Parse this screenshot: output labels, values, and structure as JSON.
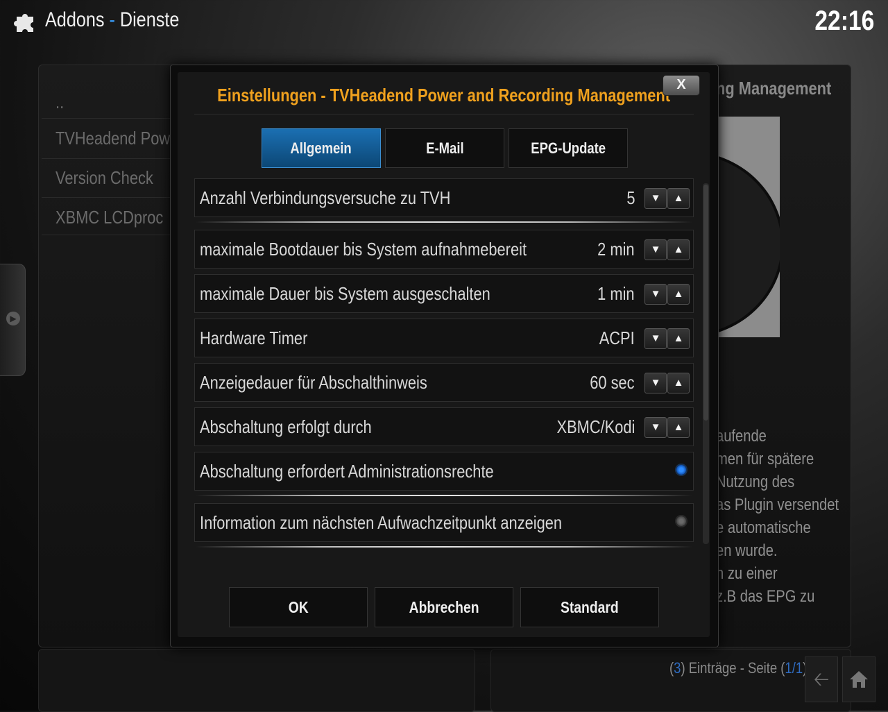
{
  "header": {
    "section": "Addons",
    "separator": "-",
    "category": "Dienste",
    "icon": "puzzle-icon",
    "time": "22:16"
  },
  "background": {
    "list": [
      "..",
      "TVHeadend Power",
      "Version Check",
      "XBMC LCDproc"
    ],
    "heading": "ng Management",
    "description": [
      "aufende",
      "men für spätere",
      "Nutzung des",
      "as Plugin versendet",
      "e automatische",
      "en wurde.",
      "n zu einer",
      "z.B das EPG zu"
    ],
    "footer": {
      "count": "3",
      "count_open": "(",
      "count_close": ")",
      "entries_text": " Einträge - Seite ",
      "page_open": "(",
      "page": "1/1",
      "page_close": ")"
    }
  },
  "dialog": {
    "title": "Einstellungen - TVHeadend Power and Recording Management",
    "close_label": "X",
    "tabs": [
      "Allgemein",
      "E-Mail",
      "EPG-Update"
    ],
    "active_tab": "Allgemein",
    "settings": [
      {
        "label": "Anzahl Verbindungsversuche zu TVH",
        "value": "5",
        "type": "spinner"
      },
      {
        "label": "maximale Bootdauer bis System aufnahmebereit",
        "value": "2 min",
        "type": "spinner"
      },
      {
        "label": "maximale Dauer bis System ausgeschalten",
        "value": "1 min",
        "type": "spinner"
      },
      {
        "label": "Hardware Timer",
        "value": "ACPI",
        "type": "spinner"
      },
      {
        "label": "Anzeigedauer für Abschalthinweis",
        "value": "60 sec",
        "type": "spinner"
      },
      {
        "label": "Abschaltung erfolgt durch",
        "value": "XBMC/Kodi",
        "type": "spinner"
      },
      {
        "label": "Abschaltung erfordert Administrationsrechte",
        "value": "on",
        "type": "radio"
      },
      {
        "label": "Information zum nächsten Aufwachzeitpunkt anzeigen",
        "value": "off",
        "type": "radio"
      }
    ],
    "spinner_down": "▼",
    "spinner_up": "▲",
    "buttons": {
      "ok": "OK",
      "cancel": "Abbrechen",
      "default": "Standard"
    }
  },
  "nav": {
    "back_icon": "back-arrow-icon",
    "home_icon": "home-icon",
    "side_icon": "chevron-right-icon"
  },
  "colors": {
    "accent": "#1b6fb2",
    "title": "#f0a11e",
    "radio_on": "#2e8cff"
  }
}
